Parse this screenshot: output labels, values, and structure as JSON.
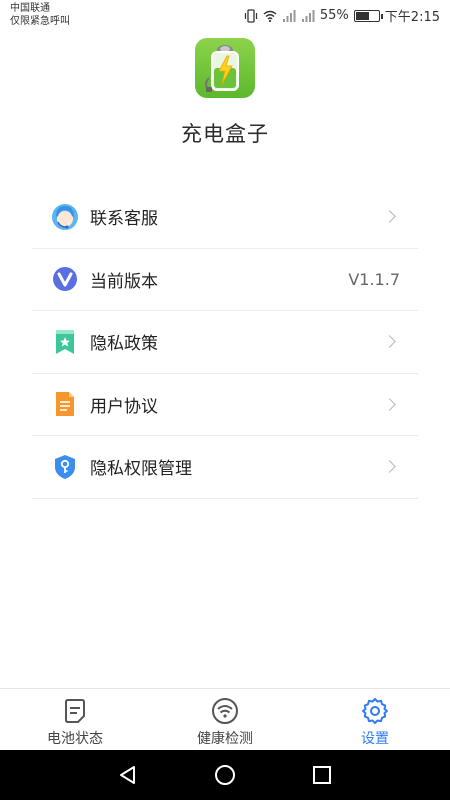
{
  "status_bar": {
    "carrier": "中国联通",
    "carrier_sub": "仅限紧急呼叫",
    "battery_percent_text": "55%",
    "battery_level": 0.55,
    "time": "下午2:15"
  },
  "header": {
    "app_name": "充电盒子"
  },
  "menu": {
    "items": [
      {
        "label": "联系客服",
        "icon": "customer-service-icon"
      },
      {
        "label": "当前版本",
        "value": "V1.1.7",
        "icon": "version-icon"
      },
      {
        "label": "隐私政策",
        "icon": "privacy-policy-icon"
      },
      {
        "label": "用户协议",
        "icon": "user-agreement-icon"
      },
      {
        "label": "隐私权限管理",
        "icon": "privacy-permission-icon"
      }
    ]
  },
  "tabs": [
    {
      "label": "电池状态",
      "icon": "battery-status-icon"
    },
    {
      "label": "健康检测",
      "icon": "health-check-icon"
    },
    {
      "label": "设置",
      "icon": "settings-icon",
      "active": true
    }
  ],
  "colors": {
    "accent": "#2f7cf6",
    "logo_green": "#6cc23a"
  }
}
